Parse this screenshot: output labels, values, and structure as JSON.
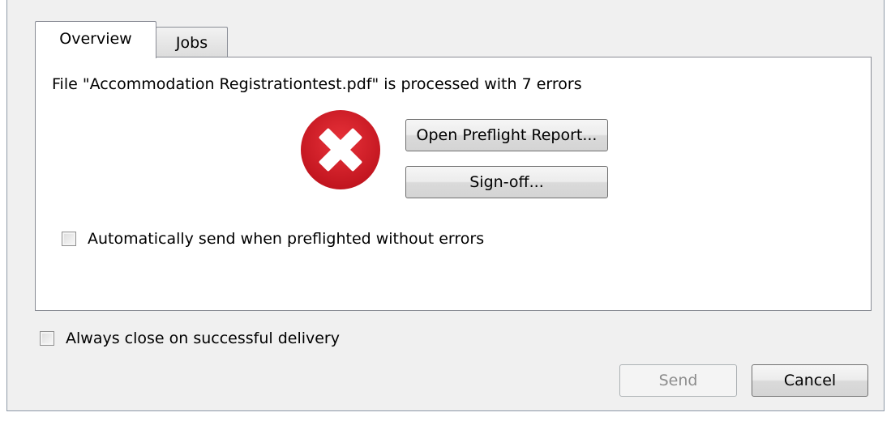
{
  "tabs": [
    {
      "label": "Overview",
      "selected": true
    },
    {
      "label": "Jobs",
      "selected": false
    }
  ],
  "overview": {
    "status_message": "File \"Accommodation Registrationtest.pdf\" is processed with 7 errors",
    "status_icon": "error-x-icon",
    "status_color": "#d0202a",
    "open_report_label": "Open Preflight Report...",
    "signoff_label": "Sign-off...",
    "auto_send_label": "Automatically send when preflighted without errors",
    "auto_send_checked": false
  },
  "footer": {
    "always_close_label": "Always close on successful delivery",
    "always_close_checked": false,
    "send_label": "Send",
    "send_enabled": false,
    "cancel_label": "Cancel"
  }
}
